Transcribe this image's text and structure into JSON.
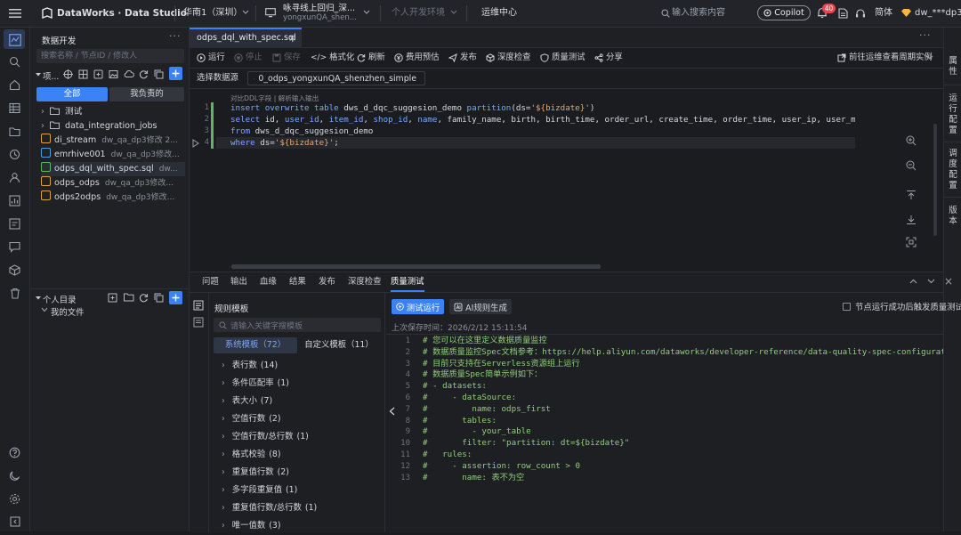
{
  "topbar": {
    "brand": "DataWorks · Data Studio",
    "region": "华南1（深圳）",
    "workspace_title": "咏寻线上回归_深...",
    "workspace_sub": "yongxunQA_shen...",
    "env": "个人开发环境",
    "ops_center": "运维中心",
    "search_placeholder": "输入搜索内容",
    "copilot": "Copilot",
    "notif_count": "40",
    "lang": "简体",
    "user": "dw_***dp3"
  },
  "explorer": {
    "title": "数据开发",
    "search_placeholder": "搜索名称 / 节点ID / 修改人",
    "project_label": "项...",
    "filter_all": "全部",
    "filter_mine": "我负责的",
    "tree": [
      {
        "type": "folder",
        "name": "测试",
        "sub": ""
      },
      {
        "type": "folder",
        "name": "data_integration_jobs",
        "sub": ""
      },
      {
        "type": "file",
        "name": "di_stream",
        "sub": "dw_qa_dp3修改 2..."
      },
      {
        "type": "file",
        "name": "emrhive001",
        "sub": "dw_qa_dp3修改..."
      },
      {
        "type": "file",
        "name": "odps_dql_with_spec.sql",
        "sub": "dw..."
      },
      {
        "type": "file",
        "name": "odps_odps",
        "sub": "dw_qa_dp3修改..."
      },
      {
        "type": "file",
        "name": "odps2odps",
        "sub": "dw_qa_dp3修改..."
      }
    ],
    "personal_title": "个人目录",
    "my_files": "我的文件"
  },
  "editor": {
    "tab_label": "odps_dql_with_spec.sql",
    "toolbar": {
      "run": "运行",
      "stop": "停止",
      "save": "保存",
      "format": "格式化",
      "refresh": "刷新",
      "cost": "费用预估",
      "publish": "发布",
      "deep_check": "深度检查",
      "quality_test": "质量测试",
      "share": "分享",
      "goto_ops": "前往运维查看周期实例"
    },
    "datasource_label": "选择数据源",
    "datasource_value": "0_odps_yongxunQA_shenzhen_simple",
    "hint": "对比DDL字段 | 解析输入输出",
    "code_lines": [
      [
        {
          "c": "kw",
          "t": "insert overwrite table "
        },
        {
          "c": "pl",
          "t": "dws_d_dqc_suggesion_demo "
        },
        {
          "c": "kw",
          "t": "partition"
        },
        {
          "c": "pl",
          "t": "(ds="
        },
        {
          "c": "st",
          "t": "'${bizdate}'"
        },
        {
          "c": "pl",
          "t": ")"
        }
      ],
      [
        {
          "c": "kw",
          "t": "select "
        },
        {
          "c": "pl",
          "t": "id, "
        },
        {
          "c": "kw",
          "t": "user_id"
        },
        {
          "c": "pl",
          "t": ", "
        },
        {
          "c": "kw",
          "t": "item_id"
        },
        {
          "c": "pl",
          "t": ", "
        },
        {
          "c": "kw",
          "t": "shop_id"
        },
        {
          "c": "pl",
          "t": ", "
        },
        {
          "c": "kw",
          "t": "name"
        },
        {
          "c": "pl",
          "t": ", family_name, birth, birth_time, order_url, create_time, order_time, user_ip, user_mac, user_"
        }
      ],
      [
        {
          "c": "kw",
          "t": "from "
        },
        {
          "c": "pl",
          "t": "dws_d_dqc_suggesion_demo"
        }
      ],
      [
        {
          "c": "kw",
          "t": "where "
        },
        {
          "c": "pl",
          "t": "ds="
        },
        {
          "c": "st",
          "t": "'${bizdate}'"
        },
        {
          "c": "pl",
          "t": ";"
        }
      ]
    ]
  },
  "right_panel": {
    "properties": "属性",
    "run_config": "运行配置",
    "schedule_config": "调度配置",
    "version": "版本"
  },
  "bottom": {
    "tabs": [
      "问题",
      "输出",
      "血缘",
      "结果",
      "发布",
      "深度检查",
      "质量测试"
    ],
    "active_tab": "质量测试",
    "rule_templates_title": "规则模板",
    "template_search_placeholder": "请输入关键字搜模板",
    "sys_templates": "系统模板（72）",
    "custom_templates": "自定义模板（11）",
    "templates": [
      {
        "name": "表行数",
        "count": "(14)"
      },
      {
        "name": "条件匹配率",
        "count": "(1)"
      },
      {
        "name": "表大小",
        "count": "(7)"
      },
      {
        "name": "空值行数",
        "count": "(2)"
      },
      {
        "name": "空值行数/总行数",
        "count": "(1)"
      },
      {
        "name": "格式校验",
        "count": "(8)"
      },
      {
        "name": "重复值行数",
        "count": "(2)"
      },
      {
        "name": "多字段重复值",
        "count": "(1)"
      },
      {
        "name": "重复值行数/总行数",
        "count": "(1)"
      },
      {
        "name": "唯一值数",
        "count": "(3)"
      }
    ],
    "test_run": "测试运行",
    "ai_generate": "AI规则生成",
    "trigger_label": "节点运行成功后触发质量测试",
    "last_saved": "上次保存时间：2026/2/12 15:11:54",
    "spec_lines": [
      "# 您可以在这里定义数据质量监控",
      "# 数据质量监控Spec文档参考：https://help.aliyun.com/dataworks/developer-reference/data-quality-spec-configuration-guide",
      "# 目前只支持在Serverless资源组上运行",
      "# 数据质量Spec简单示例如下：",
      "# - datasets:",
      "#     - dataSource:",
      "#         name: odps_first",
      "#       tables:",
      "#         - your_table",
      "#       filter: \"partition: dt=${bizdate}\"",
      "#   rules:",
      "#     - assertion: row_count > 0",
      "#       name: 表不为空"
    ]
  }
}
